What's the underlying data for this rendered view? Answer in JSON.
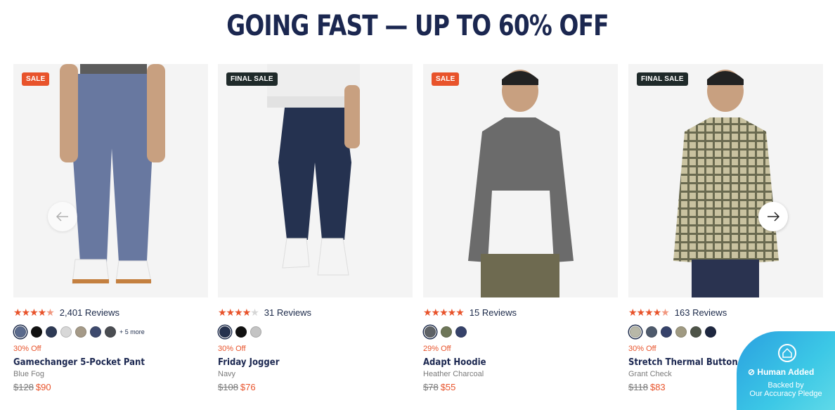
{
  "headline": "GOING FAST — UP TO 60% OFF",
  "products": [
    {
      "badge": "SALE",
      "badge_type": "sale",
      "stars": "★★★★★",
      "rating": 4.5,
      "reviews": "2,401 Reviews",
      "swatches": [
        "#5a6a8c",
        "#111111",
        "#2e3a55",
        "#d8d8d8",
        "#a59a88",
        "#3e4a6e",
        "#4a4d52"
      ],
      "more": "+ 5 more",
      "discount": "30% Off",
      "name": "Gamechanger 5-Pocket Pant",
      "color": "Blue Fog",
      "old_price": "$128",
      "new_price": "$90"
    },
    {
      "badge": "FINAL SALE",
      "badge_type": "final",
      "stars": "★★★★★",
      "rating": 4.0,
      "reviews": "31 Reviews",
      "swatches": [
        "#26324e",
        "#111111",
        "#c4c4c4"
      ],
      "more": "",
      "discount": "30% Off",
      "name": "Friday Jogger",
      "color": "Navy",
      "old_price": "$108",
      "new_price": "$76"
    },
    {
      "badge": "SALE",
      "badge_type": "sale",
      "stars": "★★★★★",
      "rating": 5.0,
      "reviews": "15 Reviews",
      "swatches": [
        "#5e6266",
        "#6e7658",
        "#36426a"
      ],
      "more": "",
      "discount": "29% Off",
      "name": "Adapt Hoodie",
      "color": "Heather Charcoal",
      "old_price": "$78",
      "new_price": "$55"
    },
    {
      "badge": "FINAL SALE",
      "badge_type": "final",
      "stars": "★★★★★",
      "rating": 4.5,
      "reviews": "163 Reviews",
      "swatches": [
        "#b8b8a8",
        "#4e5a6c",
        "#36426a",
        "#a09a82",
        "#4e5448",
        "#1e2740"
      ],
      "more": "",
      "discount": "30% Off",
      "name": "Stretch Thermal Button Down",
      "color": "Grant Check",
      "old_price": "$118",
      "new_price": "$83"
    }
  ],
  "pledge": {
    "title": "Human Added",
    "line1": "Backed by",
    "line2": "Our Accuracy Pledge"
  },
  "icons": {
    "prev": "arrow-left-icon",
    "next": "arrow-right-icon"
  }
}
